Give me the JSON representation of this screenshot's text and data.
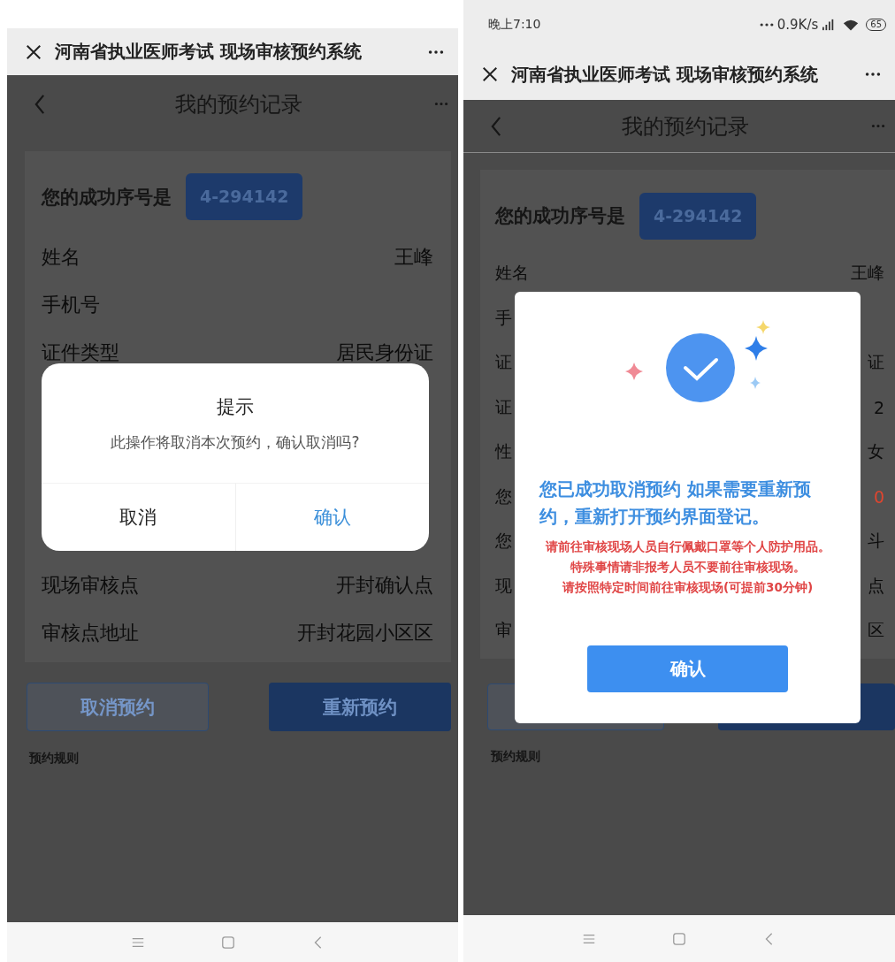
{
  "screens": [
    {
      "browser_bar": {
        "title": "河南省执业医师考试 现场审核预约系统"
      },
      "header": {
        "title": "我的预约记录"
      },
      "serial": {
        "label": "您的成功序号是",
        "value": "4-294142"
      },
      "rows": [
        {
          "label": "姓名",
          "value": "王峰",
          "highlight": false
        },
        {
          "label": "手机号",
          "highlight": false
        },
        {
          "label": "证件类型",
          "value": "居民身份证",
          "highlight": false
        }
      ],
      "rows_below": [
        {
          "label": "现场审核点",
          "value": "开封确认点",
          "highlight": false
        },
        {
          "label": "审核点地址",
          "value": "开封花园小区区",
          "highlight": false
        }
      ],
      "buttons": [
        {
          "kind": "outline",
          "label": "取消预约"
        },
        {
          "kind": "filled",
          "label": "重新预约"
        }
      ],
      "rules_label": "预约规则",
      "dialog": {
        "kind": "confirm",
        "title": "提示",
        "message": "此操作将取消本次预约，确认取消吗?",
        "cancel": "取消",
        "confirm": "确认"
      }
    },
    {
      "status_bar": {
        "time": "晚上7:10",
        "speed": "0.9K/s",
        "battery": "65"
      },
      "browser_bar": {
        "title": "河南省执业医师考试 现场审核预约系统"
      },
      "header": {
        "title": "我的预约记录"
      },
      "serial": {
        "label": "您的成功序号是",
        "value": "4-294142"
      },
      "rows": [
        {
          "label": "姓名",
          "value": "王峰",
          "highlight": false
        },
        {
          "label": "手",
          "highlight": false
        },
        {
          "label": "证",
          "value": "证",
          "highlight": false
        },
        {
          "label": "证",
          "value": "2",
          "highlight": false
        },
        {
          "label": "性",
          "value": "女",
          "highlight": false
        },
        {
          "label": "您",
          "value": "0",
          "highlight": true
        },
        {
          "label": "您",
          "value": "斗",
          "highlight": false
        },
        {
          "label": "现",
          "value": "点",
          "highlight": false
        },
        {
          "label": "审",
          "value": "区",
          "highlight": false
        }
      ],
      "buttons": [
        {
          "kind": "outline"
        },
        {
          "kind": "filled"
        }
      ],
      "rules_label": "预约规则",
      "dialog": {
        "kind": "success",
        "message": "您已成功取消预约 如果需要重新预约，重新打开预约界面登记。",
        "notices": [
          "请前往审核现场人员自行佩戴口罩等个人防护用品。",
          "特殊事情请非报考人员不要前往审核现场。",
          "请按照特定时间前往审核现场(可提前30分钟)"
        ],
        "confirm": "确认"
      }
    }
  ]
}
